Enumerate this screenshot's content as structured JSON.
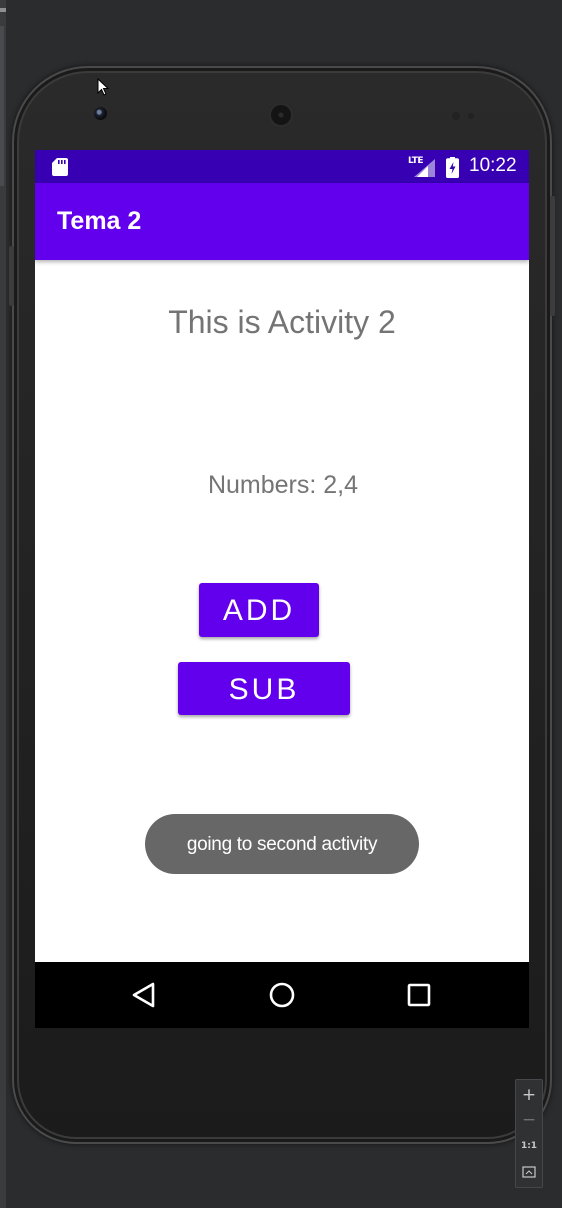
{
  "status_bar": {
    "network_label": "LTE",
    "time": "10:22"
  },
  "app_bar": {
    "title": "Tema 2"
  },
  "content": {
    "activity_title": "This is Activity 2",
    "numbers_text": "Numbers: 2,4",
    "add_button_label": "ADD",
    "sub_button_label": "SUB"
  },
  "toast": {
    "message": "going to second activity"
  },
  "emulator_toolbar": {
    "zoom_in_label": "+",
    "zoom_out_label": "−",
    "actual_size_label": "1:1"
  },
  "icons": {
    "status_sd": "sd-card-icon",
    "status_signal": "signal-icon",
    "status_battery": "battery-charging-icon",
    "nav_back": "back-triangle-icon",
    "nav_home": "home-circle-icon",
    "nav_recents": "recents-square-icon",
    "zoom_fit": "fit-screen-icon"
  },
  "colors": {
    "status_bar": "#3700b3",
    "primary": "#6200ee",
    "body_text": "#757575",
    "toast_background": "#676767",
    "nav_bar": "#000000"
  }
}
